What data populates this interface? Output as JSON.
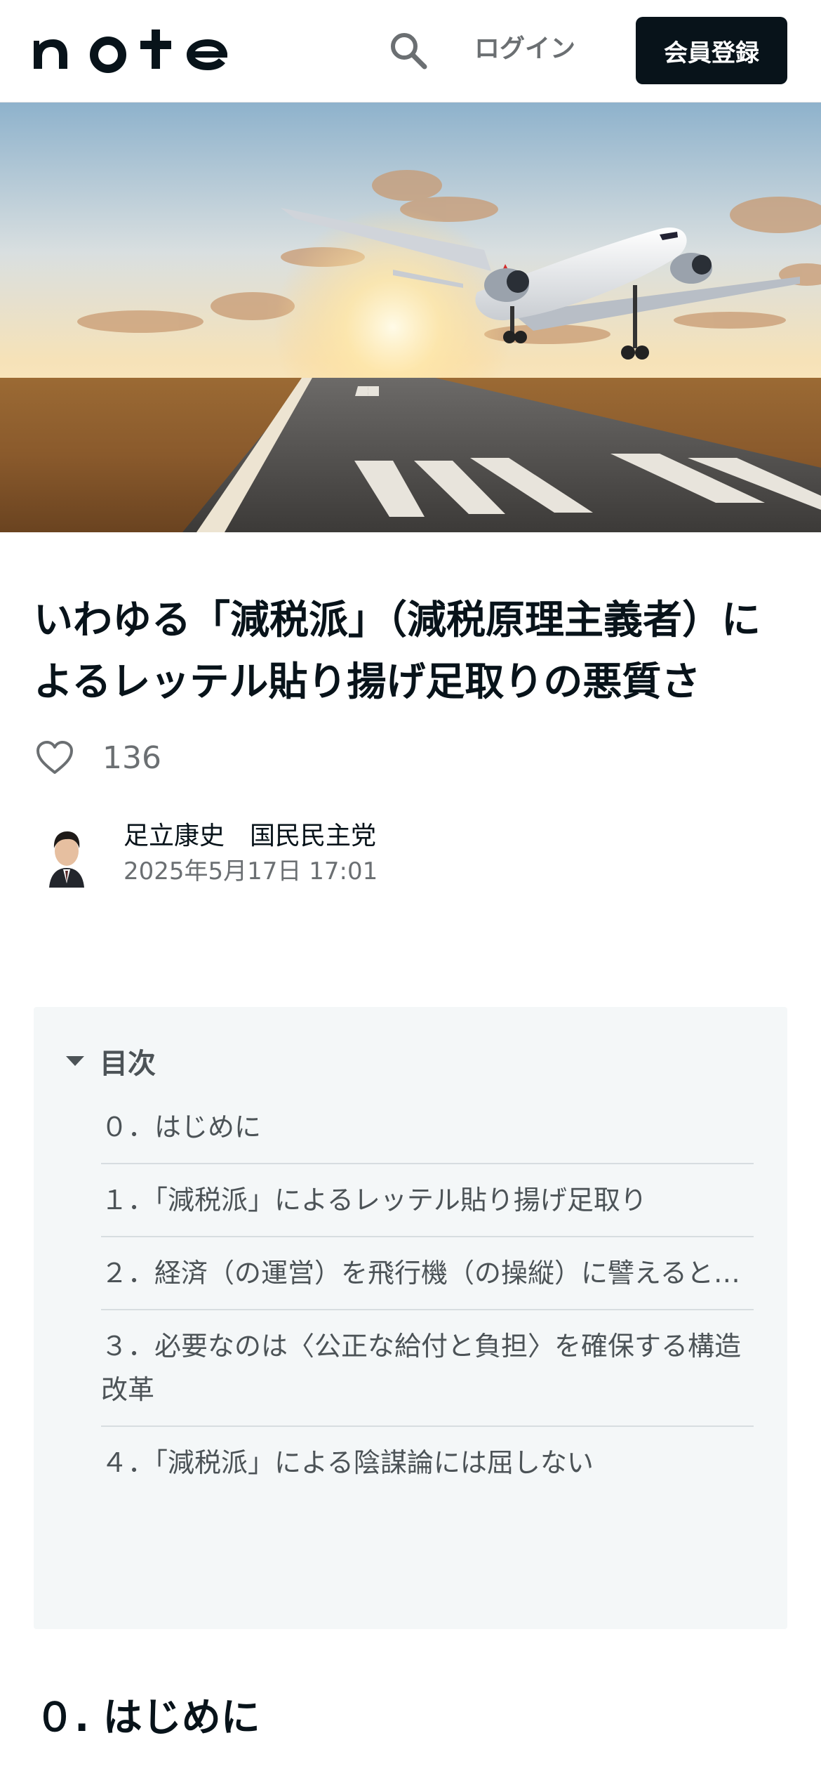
{
  "header": {
    "logo_text": "note",
    "login_label": "ログイン",
    "signup_label": "会員登録"
  },
  "article": {
    "title": "いわゆる「減税派」（減税原理主義者）によるレッテル貼り揚げ足取りの悪質さ",
    "likes": "136",
    "author_name": "足立康史　国民民主党",
    "date": "2025年5月17日 17:01"
  },
  "toc": {
    "title": "目次",
    "items": [
      "０．はじめに",
      "１．「減税派」によるレッテル貼り揚げ足取り",
      "２．経済（の運営）を飛行機（の操縦）に譬えると…",
      "３．必要なのは〈公正な給付と負担〉を確保する構造改革",
      "４．「減税派」による陰謀論には屈しない"
    ]
  },
  "section": {
    "heading": "０. はじめに"
  },
  "colors": {
    "brand_dark": "#08131a",
    "toc_bg": "#f4f7f8",
    "muted_text": "#6b6f72"
  }
}
